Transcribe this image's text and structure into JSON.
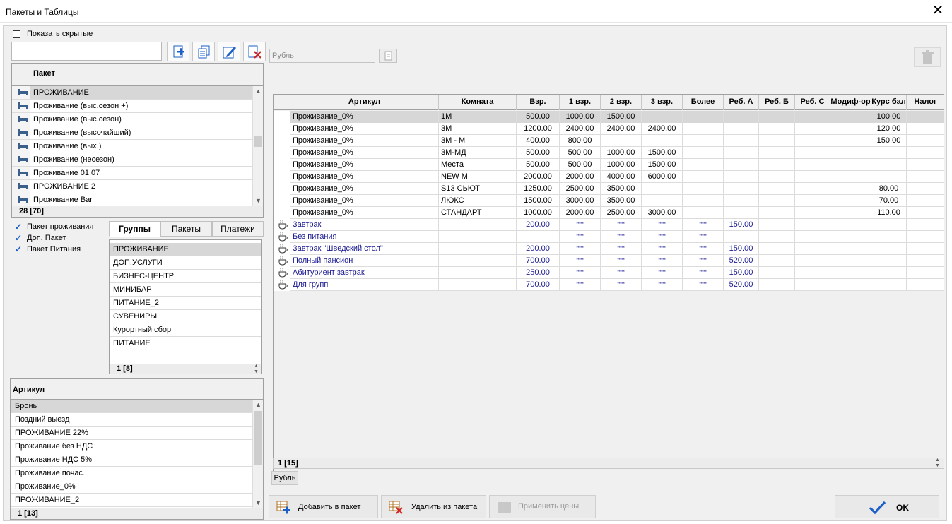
{
  "window": {
    "title": "Пакеты и Таблицы",
    "close_glyph": "✕"
  },
  "left": {
    "show_hidden_label": "Показать скрытые",
    "search_value": "",
    "packages": {
      "header": "Пакет",
      "items": [
        "ПРОЖИВАНИЕ",
        "Проживание (выс.сезон +)",
        "Проживание (выс.сезон)",
        "Проживание (высочайший)",
        "Проживание (вых.)",
        "Проживание (несезон)",
        "Проживание 01.07",
        "ПРОЖИВАНИЕ 2",
        "Проживание Bar"
      ],
      "footer": "28 [70]"
    },
    "checks": [
      "Пакет проживания",
      "Доп. Пакет",
      "Пакет Питания"
    ],
    "tabs": [
      "Группы",
      "Пакеты",
      "Платежи"
    ],
    "groups": {
      "items": [
        "ПРОЖИВАНИЕ",
        "ДОП.УСЛУГИ",
        "БИЗНЕС-ЦЕНТР",
        "МИНИБАР",
        "ПИТАНИЕ_2",
        "СУВЕНИРЫ",
        "Курортный сбор",
        "ПИТАНИЕ"
      ],
      "footer": "1 [8]"
    },
    "articles": {
      "header": "Артикул",
      "items": [
        "Бронь",
        "Поздний выезд",
        "ПРОЖИВАНИЕ 22%",
        "Проживание без НДС",
        "Проживание НДС 5%",
        "Проживание почас.",
        "Проживание_0%",
        "ПРОЖИВАНИЕ_2"
      ],
      "footer": "1 [13]"
    }
  },
  "right": {
    "currency_value": "Рубль",
    "columns": [
      "Артикул",
      "Комната",
      "Взр.",
      "1 взр.",
      "2 взр.",
      "3 взр.",
      "Более",
      "Реб. А",
      "Реб. Б",
      "Реб. С",
      "Модиф-ор",
      "Курс бал",
      "Налог"
    ],
    "rows": [
      {
        "cells": [
          "Проживание_0%",
          "1М",
          "500.00",
          "1000.00",
          "1500.00",
          "",
          "",
          "",
          "",
          "",
          "",
          "100.00",
          ""
        ],
        "icon": "",
        "blue": false
      },
      {
        "cells": [
          "Проживание_0%",
          "3М",
          "1200.00",
          "2400.00",
          "2400.00",
          "2400.00",
          "",
          "",
          "",
          "",
          "",
          "120.00",
          ""
        ],
        "icon": "",
        "blue": false
      },
      {
        "cells": [
          "Проживание_0%",
          "3М - М",
          "400.00",
          "800.00",
          "",
          "",
          "",
          "",
          "",
          "",
          "",
          "150.00",
          ""
        ],
        "icon": "",
        "blue": false
      },
      {
        "cells": [
          "Проживание_0%",
          "3М-МД",
          "500.00",
          "500.00",
          "1000.00",
          "1500.00",
          "",
          "",
          "",
          "",
          "",
          "",
          ""
        ],
        "icon": "",
        "blue": false
      },
      {
        "cells": [
          "Проживание_0%",
          "Места",
          "500.00",
          "500.00",
          "1000.00",
          "1500.00",
          "",
          "",
          "",
          "",
          "",
          "",
          ""
        ],
        "icon": "",
        "blue": false
      },
      {
        "cells": [
          "Проживание_0%",
          "NEW M",
          "2000.00",
          "2000.00",
          "4000.00",
          "6000.00",
          "",
          "",
          "",
          "",
          "",
          "",
          ""
        ],
        "icon": "",
        "blue": false
      },
      {
        "cells": [
          "Проживание_0%",
          "S13 СЬЮТ",
          "1250.00",
          "2500.00",
          "3500.00",
          "",
          "",
          "",
          "",
          "",
          "",
          "80.00",
          ""
        ],
        "icon": "",
        "blue": false
      },
      {
        "cells": [
          "Проживание_0%",
          "ЛЮКС",
          "1500.00",
          "3000.00",
          "3500.00",
          "",
          "",
          "",
          "",
          "",
          "",
          "70.00",
          ""
        ],
        "icon": "",
        "blue": false
      },
      {
        "cells": [
          "Проживание_0%",
          "СТАНДАРТ",
          "1000.00",
          "2000.00",
          "2500.00",
          "3000.00",
          "",
          "",
          "",
          "",
          "",
          "110.00",
          ""
        ],
        "icon": "",
        "blue": false
      },
      {
        "cells": [
          "Завтрак",
          "",
          "200.00",
          "*****",
          "*****",
          "*****",
          "*****",
          "150.00",
          "",
          "",
          "",
          "",
          ""
        ],
        "icon": "cup-icon",
        "blue": true
      },
      {
        "cells": [
          "Без питания",
          "",
          "",
          "*****",
          "*****",
          "*****",
          "*****",
          "",
          "",
          "",
          "",
          "",
          ""
        ],
        "icon": "cup-icon",
        "blue": true
      },
      {
        "cells": [
          "Завтрак \"Шведский стол\"",
          "",
          "200.00",
          "*****",
          "*****",
          "*****",
          "*****",
          "150.00",
          "",
          "",
          "",
          "",
          ""
        ],
        "icon": "cup-icon",
        "blue": true
      },
      {
        "cells": [
          "Полный пансион",
          "",
          "700.00",
          "*****",
          "*****",
          "*****",
          "*****",
          "520.00",
          "",
          "",
          "",
          "",
          ""
        ],
        "icon": "cup-icon",
        "blue": true
      },
      {
        "cells": [
          "Абитуриент завтрак",
          "",
          "250.00",
          "*****",
          "*****",
          "*****",
          "*****",
          "150.00",
          "",
          "",
          "",
          "",
          ""
        ],
        "icon": "cup-icon",
        "blue": true
      },
      {
        "cells": [
          "Для групп",
          "",
          "700.00",
          "*****",
          "*****",
          "*****",
          "*****",
          "520.00",
          "",
          "",
          "",
          "",
          ""
        ],
        "icon": "cup-icon",
        "blue": true
      }
    ],
    "footer": "1 [15]",
    "currency_tab": "Рубль"
  },
  "buttons": {
    "add": "Добавить в пакет",
    "remove": "Удалить из пакета",
    "apply": "Применить цены",
    "ok": "OK"
  },
  "colors": {
    "accent": "#1b5fc7",
    "selection": "#d7d7d7",
    "blue_text": "#1a1a90"
  }
}
